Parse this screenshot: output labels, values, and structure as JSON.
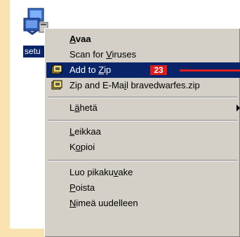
{
  "colors": {
    "background_frame": "#f9e4b1",
    "menu_bg": "#d4d0c8",
    "selection": "#0a246a",
    "annotation_red": "#e01d1d"
  },
  "file": {
    "label": "setu",
    "icon": "setup-package-icon"
  },
  "menu": {
    "items": [
      {
        "pre": "",
        "mn": "A",
        "post": "vaa",
        "icon": null
      },
      {
        "pre": "Scan for ",
        "mn": "V",
        "post": "iruses",
        "icon": null
      },
      {
        "pre": "Add to ",
        "mn": "Z",
        "post": "ip",
        "icon": "winzip-icon"
      },
      {
        "pre": "Zip and E-Ma",
        "mn": "i",
        "post": "l bravedwarfes.zip",
        "icon": "winzip-icon"
      },
      {
        "pre": "L",
        "mn": "ä",
        "post": "hetä",
        "icon": null
      },
      {
        "pre": "",
        "mn": "L",
        "post": "eikkaa",
        "icon": null
      },
      {
        "pre": "K",
        "mn": "o",
        "post": "pioi",
        "icon": null
      },
      {
        "pre": "Luo pikaku",
        "mn": "v",
        "post": "ake",
        "icon": null
      },
      {
        "pre": "",
        "mn": "P",
        "post": "oista",
        "icon": null
      },
      {
        "pre": "",
        "mn": "N",
        "post": "imeä uudelleen",
        "icon": null
      }
    ],
    "submenu_arrow_icon": "submenu-arrow-icon"
  },
  "annotation": {
    "badge": "23"
  }
}
